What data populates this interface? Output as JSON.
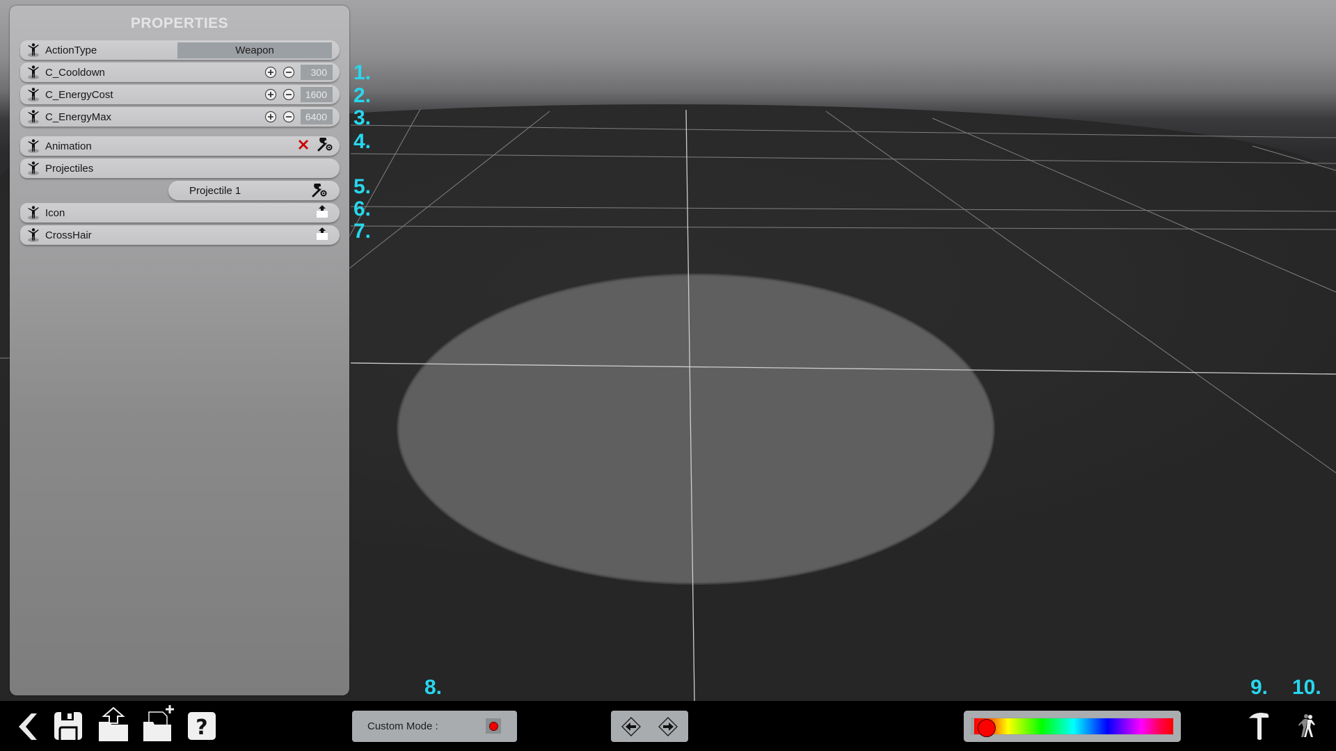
{
  "panel": {
    "title": "PROPERTIES",
    "rows": [
      {
        "label": "ActionType",
        "value": "Weapon",
        "kind": "select"
      },
      {
        "label": "C_Cooldown",
        "value": "300",
        "kind": "number"
      },
      {
        "label": "C_EnergyCost",
        "value": "1600",
        "kind": "number"
      },
      {
        "label": "C_EnergyMax",
        "value": "6400",
        "kind": "number"
      },
      {
        "label": "Animation",
        "kind": "asset",
        "actions": [
          "delete-icon",
          "wrench-gear-icon"
        ]
      },
      {
        "label": "Projectiles",
        "kind": "group"
      },
      {
        "label": "Icon",
        "kind": "upload",
        "actions": [
          "upload-icon"
        ]
      },
      {
        "label": "CrossHair",
        "kind": "upload",
        "actions": [
          "upload-icon"
        ]
      }
    ],
    "sub_items": [
      {
        "label": "Projectile 1",
        "actions": [
          "wrench-gear-icon"
        ]
      }
    ]
  },
  "annotations": [
    "1.",
    "2.",
    "3.",
    "4.",
    "5.",
    "6.",
    "7.",
    "8.",
    "9.",
    "10."
  ],
  "toolbar": {
    "left_icons": [
      "back-chevron-icon",
      "save-floppy-icon",
      "open-folder-upload-icon",
      "new-folder-file-icon",
      "help-question-icon"
    ],
    "custom_mode": {
      "label": "Custom Mode :",
      "enabled": true,
      "indicator_color": "#ee0000"
    },
    "nav_icons": [
      "arrow-left-diamond-icon",
      "arrow-right-diamond-icon"
    ],
    "color_slider": {
      "value": 0.02,
      "selected_color": "#ff0000"
    },
    "right_icons": [
      "hammer-icon",
      "walking-person-icon"
    ]
  },
  "colors": {
    "annotation": "#27d7ee",
    "delete": "#cc0000"
  }
}
